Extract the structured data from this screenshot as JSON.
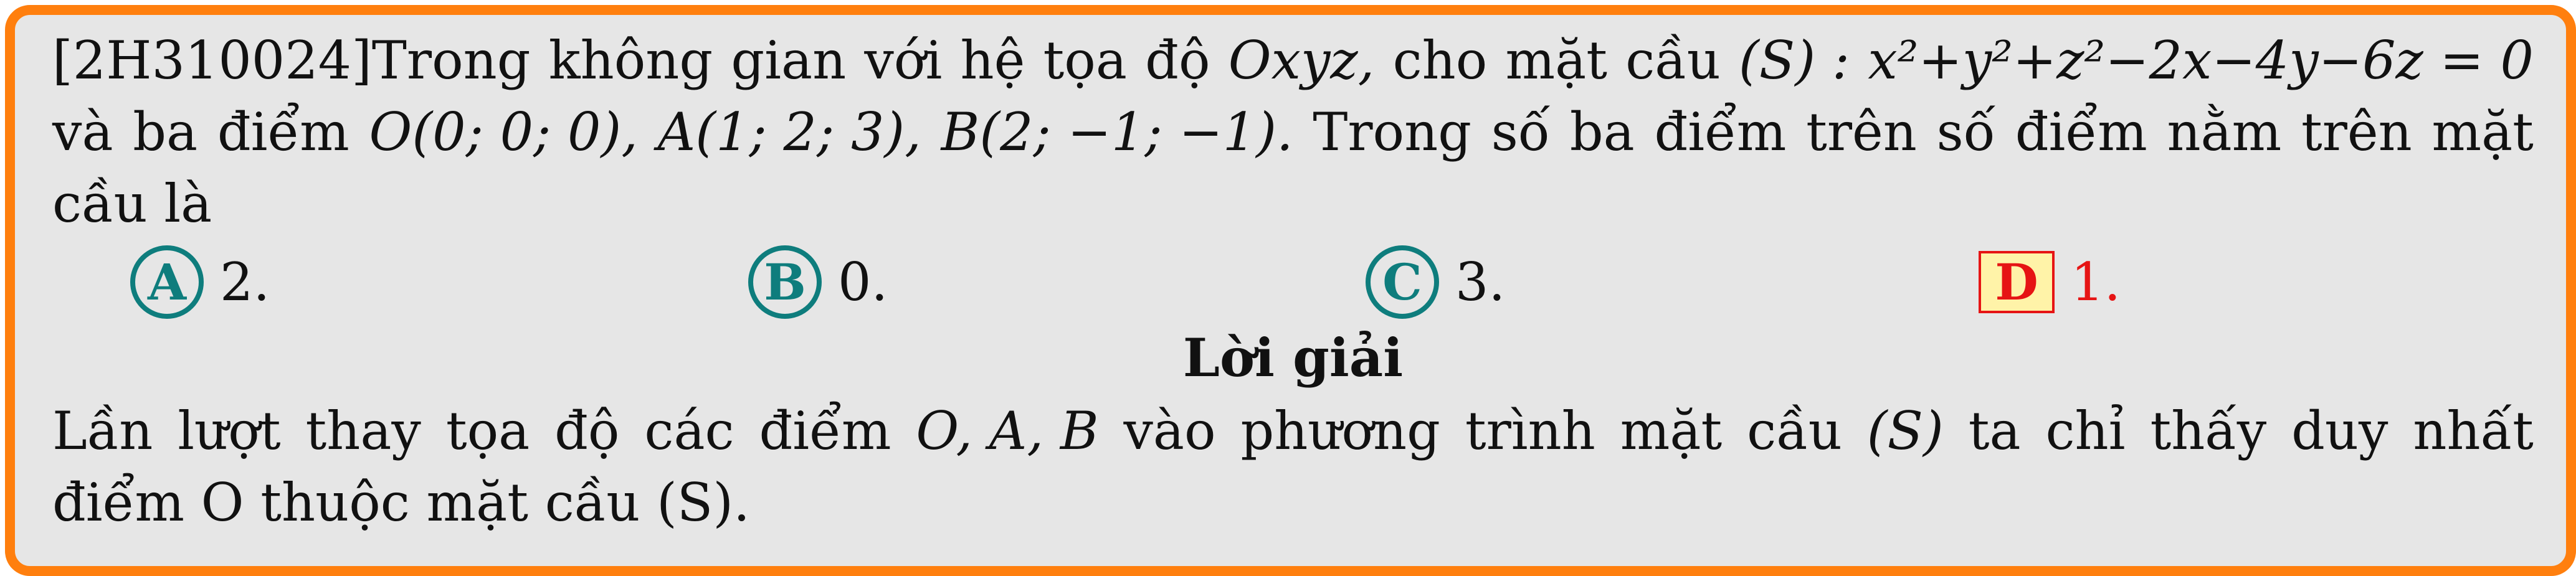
{
  "question": {
    "line1": [
      "[2H310024]Trong",
      "không",
      "gian",
      "với",
      "hệ",
      "tọa",
      "độ",
      "Oxyz,",
      "cho",
      "mặt",
      "cầu",
      "(S) :",
      "x²+y²+z²−2x−4y−6z = 0"
    ],
    "line2": [
      "và",
      "ba",
      "điểm",
      "O(0; 0; 0),",
      "A(1; 2; 3),",
      "B(2; −1; −1).",
      "Trong",
      "số",
      "ba",
      "điểm",
      "trên",
      "số",
      "điểm",
      "nằm",
      "trên",
      "mặt"
    ],
    "line3": "cầu là"
  },
  "options": [
    {
      "letter": "A",
      "text": "2."
    },
    {
      "letter": "B",
      "text": "0."
    },
    {
      "letter": "C",
      "text": "3."
    },
    {
      "letter": "D",
      "text": "1.",
      "correct": true
    }
  ],
  "solution": {
    "title": "Lời giải",
    "line1": [
      "Lần",
      "lượt",
      "thay",
      "tọa",
      "độ",
      "các",
      "điểm",
      "O, A, B",
      "vào",
      "phương",
      "trình",
      "mặt",
      "cầu",
      "(S)",
      "ta",
      "chỉ",
      "thấy",
      "duy",
      "nhất"
    ],
    "line2": "điểm O thuộc mặt cầu (S)."
  },
  "colors": {
    "frame": "#ff7f0e",
    "background": "#e6e6e6",
    "option_circle": "#0e7d7d",
    "correct": "#e61414",
    "correct_fill": "#fff3a8"
  }
}
